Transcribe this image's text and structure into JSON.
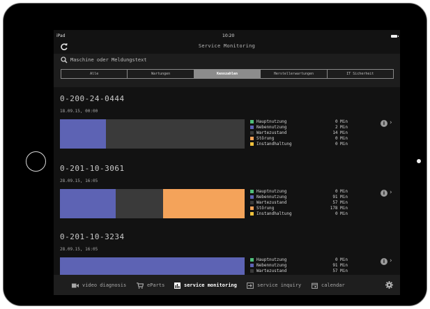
{
  "status_bar": {
    "carrier": "iPad",
    "time": "10:20"
  },
  "nav": {
    "title": "Service Monitoring",
    "refresh_icon": "refresh-icon"
  },
  "search": {
    "placeholder": "Maschine oder Meldungstext",
    "value": "",
    "icon": "search-icon"
  },
  "filter_tabs": [
    {
      "label": "Alle",
      "active": false
    },
    {
      "label": "Wartungen",
      "active": false
    },
    {
      "label": "Kennzahlen",
      "active": true
    },
    {
      "label": "Herstellerwartungen",
      "active": false
    },
    {
      "label": "IT Sicherheit",
      "active": false
    }
  ],
  "colors": {
    "hauptnutzung": "#4fbf7a",
    "nebennutzung": "#5d63b4",
    "wartezustand": "#3a3a3a",
    "stoerung": "#f4a35a",
    "instandhaltung": "#f0c23c"
  },
  "machines": [
    {
      "id": "0-200-24-0444",
      "date": "18.09.15, 00:00",
      "bar_fractions": [
        0,
        0.25,
        0.75,
        0,
        0
      ],
      "legend": [
        {
          "label": "Hauptnutzung",
          "value": "0 Min"
        },
        {
          "label": "Nebennutzung",
          "value": "2 Min"
        },
        {
          "label": "Wartezustand",
          "value": "14 Min"
        },
        {
          "label": "Störung",
          "value": "0 Min"
        },
        {
          "label": "Instandhaltung",
          "value": "0 Min"
        }
      ]
    },
    {
      "id": "0-201-10-3061",
      "date": "28.09.15, 16:05",
      "bar_fractions": [
        0,
        0.3,
        0.26,
        0.44,
        0
      ],
      "legend": [
        {
          "label": "Hauptnutzung",
          "value": "0 Min"
        },
        {
          "label": "Nebennutzung",
          "value": "91 Min"
        },
        {
          "label": "Wartezustand",
          "value": "57 Min"
        },
        {
          "label": "Störung",
          "value": "178 Min"
        },
        {
          "label": "Instandhaltung",
          "value": "0 Min"
        }
      ]
    },
    {
      "id": "0-201-10-3234",
      "date": "28.09.15, 16:05",
      "bar_fractions": [
        0,
        1,
        0,
        0,
        0
      ],
      "legend": [
        {
          "label": "Hauptnutzung",
          "value": "0 Min"
        },
        {
          "label": "Nebennutzung",
          "value": "91 Min"
        },
        {
          "label": "Wartezustand",
          "value": "57 Min"
        }
      ]
    }
  ],
  "tab_bar": {
    "items": [
      {
        "label": "video diagnosis",
        "icon": "video-camera-icon",
        "active": false
      },
      {
        "label": "eParts",
        "icon": "shopping-cart-icon",
        "active": false
      },
      {
        "label": "service monitoring",
        "icon": "bar-chart-icon",
        "active": true
      },
      {
        "label": "service inquiry",
        "icon": "inquiry-arrow-icon",
        "active": false
      },
      {
        "label": "calendar",
        "icon": "calendar-icon",
        "active": false
      }
    ],
    "settings_icon": "gear-icon"
  }
}
